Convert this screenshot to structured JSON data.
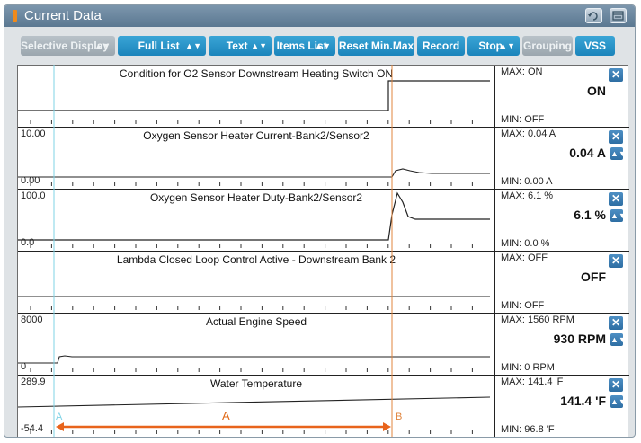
{
  "window": {
    "title": "Current Data"
  },
  "toolbar": {
    "selective_display": "Selective Display",
    "full_list": "Full List",
    "text": "Text",
    "items_list": "Items List",
    "reset_min_max": "Reset Min.Max",
    "record": "Record",
    "stop": "Stop",
    "grouping": "Grouping",
    "vss": "VSS"
  },
  "rows": [
    {
      "label": "Condition for O2 Sensor Downstream Heating Switch ON",
      "ymax": "",
      "ymin": "",
      "max": "MAX: ON",
      "value": "ON",
      "min": "MIN: OFF",
      "has_scale_button": false
    },
    {
      "label": "Oxygen Sensor Heater Current-Bank2/Sensor2",
      "ymax": "10.00",
      "ymin": "0.00",
      "max": "MAX:  0.04 A",
      "value": "0.04  A",
      "min": "MIN:  0.00 A",
      "has_scale_button": true
    },
    {
      "label": "Oxygen Sensor Heater Duty-Bank2/Sensor2",
      "ymax": "100.0",
      "ymin": "0.0",
      "max": "MAX:   6.1 %",
      "value": "6.1  %",
      "min": "MIN:   0.0 %",
      "has_scale_button": true
    },
    {
      "label": "Lambda Closed Loop Control Active - Downstream Bank 2",
      "ymax": "",
      "ymin": "",
      "max": "MAX: OFF",
      "value": "OFF",
      "min": "MIN: OFF",
      "has_scale_button": false
    },
    {
      "label": "Actual Engine Speed",
      "ymax": "8000",
      "ymin": "0",
      "max": "MAX:  1560 RPM",
      "value": "930 RPM",
      "min": "MIN:     0 RPM",
      "has_scale_button": true
    },
    {
      "label": "Water Temperature",
      "ymax": "289.9",
      "ymin": "-54.4",
      "max": "MAX: 141.4 'F",
      "value": "141.4  'F",
      "min": "MIN:  96.8 'F",
      "has_scale_button": true
    }
  ],
  "markers": {
    "a_small": "A",
    "b_small": "B",
    "a_big": "A"
  },
  "colors": {
    "accent_button": "#1e88c0",
    "marker_a": "#7fd3e6",
    "marker_b": "#e0843c",
    "arrow": "#e8641c"
  },
  "icons": {
    "retry": "retry-icon",
    "window": "window-icon",
    "close": "close-icon",
    "scale": "scale-arrows-icon"
  }
}
